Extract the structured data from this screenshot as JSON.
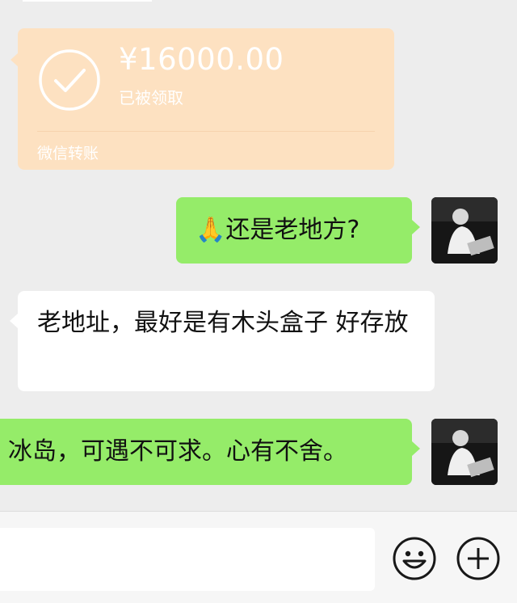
{
  "transfer": {
    "amount": "¥16000.00",
    "status": "已被领取",
    "footer": "微信转账"
  },
  "messages": [
    {
      "side": "right",
      "emoji": "🙏",
      "text": "还是老地方?"
    },
    {
      "side": "left",
      "text": "老地址，最好是有木头盒子  好存放"
    },
    {
      "side": "right",
      "text": "冰岛，可遇不可求。心有不舍。"
    }
  ],
  "colors": {
    "background": "#ededed",
    "transfer_card": "#fde1c1",
    "sent_bubble": "#95ec69",
    "received_bubble": "#ffffff"
  },
  "icons": [
    "check-circle-icon",
    "emoji-icon",
    "plus-icon"
  ]
}
